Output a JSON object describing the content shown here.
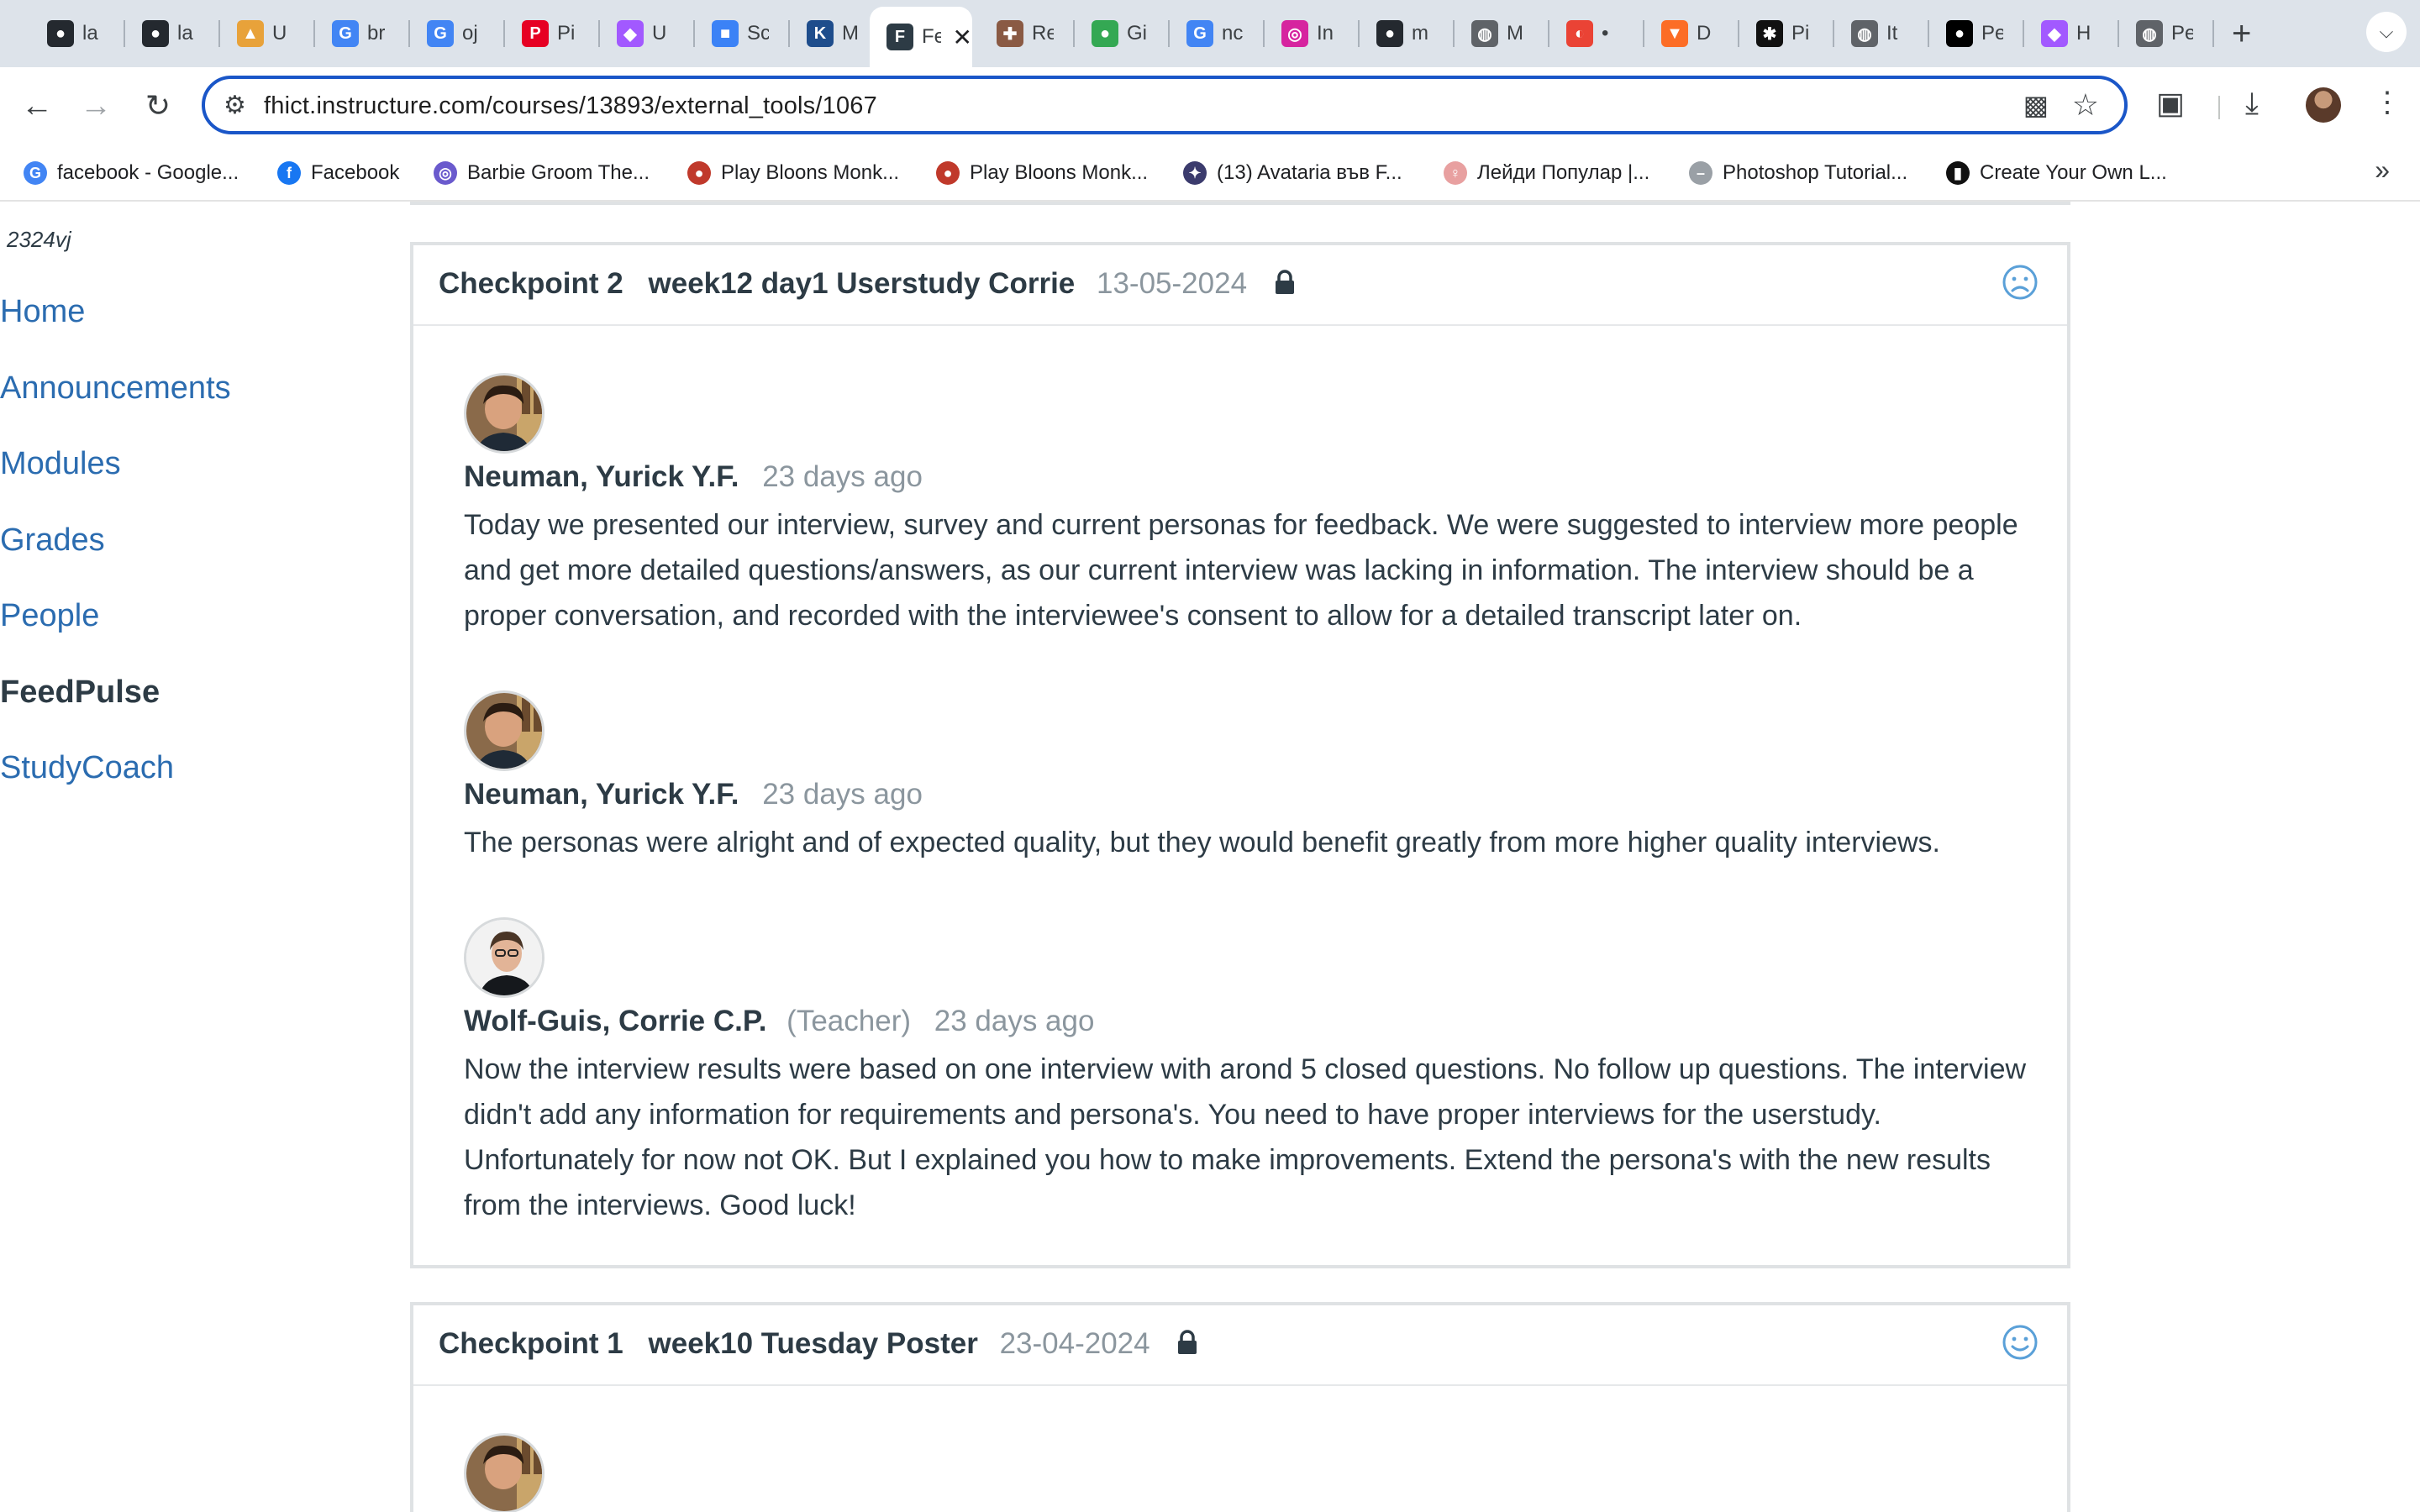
{
  "browser": {
    "tabs": [
      {
        "title": "la",
        "icon": "github-icon",
        "color": "#24292f"
      },
      {
        "title": "la",
        "icon": "github-icon",
        "color": "#24292f"
      },
      {
        "title": "U",
        "icon": "graduation-cap-icon",
        "color": "#e8a23a"
      },
      {
        "title": "br",
        "icon": "google-icon",
        "color": "#4285f4"
      },
      {
        "title": "oj",
        "icon": "google-icon",
        "color": "#4285f4"
      },
      {
        "title": "Pi",
        "icon": "pinterest-icon",
        "color": "#e60023"
      },
      {
        "title": "U",
        "icon": "figma-icon",
        "color": "#a259ff"
      },
      {
        "title": "Sc",
        "icon": "sketch-blocks-icon",
        "color": "#3b82f6"
      },
      {
        "title": "M",
        "icon": "k-icon",
        "color": "#1e4d8c"
      },
      {
        "title": "Fe",
        "icon": "feedpulse-icon",
        "color": "#2d3b45",
        "active": true
      },
      {
        "title": "Re",
        "icon": "puzzle-piece-icon",
        "color": "#8a5a44"
      },
      {
        "title": "Gi",
        "icon": "maps-pin-icon",
        "color": "#34a853"
      },
      {
        "title": "nc",
        "icon": "google-icon",
        "color": "#4285f4"
      },
      {
        "title": "In",
        "icon": "instagram-icon",
        "color": "#d6249f"
      },
      {
        "title": "m",
        "icon": "github-icon",
        "color": "#24292f"
      },
      {
        "title": "M",
        "icon": "globe-icon",
        "color": "#5f6368"
      },
      {
        "title": "•",
        "icon": "google-lens-icon",
        "color": "#ea4335"
      },
      {
        "title": "D",
        "icon": "gitlab-icon",
        "color": "#fc6d26"
      },
      {
        "title": "Pi",
        "icon": "black-logo-icon",
        "color": "#111111"
      },
      {
        "title": "It",
        "icon": "globe-icon",
        "color": "#5f6368"
      },
      {
        "title": "Pe",
        "icon": "medium-icon",
        "color": "#000000"
      },
      {
        "title": "H",
        "icon": "figma-icon",
        "color": "#a259ff"
      },
      {
        "title": "Pe",
        "icon": "globe-icon",
        "color": "#5f6368"
      }
    ],
    "url": "fhict.instructure.com/courses/13893/external_tools/1067",
    "bookmarks": [
      {
        "label": "facebook - Google...",
        "icon": "google-icon",
        "color": "#4285f4"
      },
      {
        "label": "Facebook",
        "icon": "facebook-icon",
        "color": "#1877f2"
      },
      {
        "label": "Barbie Groom The...",
        "icon": "barbie-icon",
        "color": "#6a5acd"
      },
      {
        "label": "Play Bloons Monk...",
        "icon": "bloons-icon",
        "color": "#c0392b"
      },
      {
        "label": "Play Bloons Monk...",
        "icon": "bloons-icon",
        "color": "#c0392b"
      },
      {
        "label": "(13) Avataria във F...",
        "icon": "avataria-icon",
        "color": "#3b3b6d"
      },
      {
        "label": "Лейди Популар |...",
        "icon": "lady-popular-icon",
        "color": "#e8a0a0"
      },
      {
        "label": "Photoshop Tutorial...",
        "icon": "dash-icon",
        "color": "#9aa0a6"
      },
      {
        "label": "Create Your Own L...",
        "icon": "black-square-icon",
        "color": "#111111"
      }
    ]
  },
  "sidebar": {
    "course_code": "2324vj",
    "items": [
      {
        "label": "Home",
        "active": false
      },
      {
        "label": "Announcements",
        "active": false
      },
      {
        "label": "Modules",
        "active": false
      },
      {
        "label": "Grades",
        "active": false
      },
      {
        "label": "People",
        "active": false
      },
      {
        "label": "FeedPulse",
        "active": true
      },
      {
        "label": "StudyCoach",
        "active": false
      }
    ]
  },
  "checkpoints": [
    {
      "name": "Checkpoint 2",
      "subtitle": "week12 day1 Userstudy Corrie",
      "date": "13-05-2024",
      "mood": "sad-face-icon",
      "comments": [
        {
          "author": "Neuman, Yurick Y.F.",
          "role": "",
          "ago": "23 days ago",
          "text": "Today we presented our interview, survey and current personas for feedback. We were suggested to interview more people and get more detailed questions/answers, as our current interview was lacking in information. The interview should be a proper conversation, and recorded with the interviewee's consent to allow for a detailed transcript later on."
        },
        {
          "author": "Neuman, Yurick Y.F.",
          "role": "",
          "ago": "23 days ago",
          "text": "The personas were alright and of expected quality, but they would benefit greatly from more higher quality interviews."
        },
        {
          "author": "Wolf-Guis, Corrie C.P.",
          "role": "(Teacher)",
          "ago": "23 days ago",
          "text": "Now the interview results were based on one interview with arond 5 closed questions. No follow up questions. The interview didn't add any information for requirements and persona's. You need to have proper interviews for the userstudy. Unfortunately for now not OK. But I explained you how to make improvements. Extend the persona's with the new results from the interviews. Good luck!"
        }
      ]
    },
    {
      "name": "Checkpoint 1",
      "subtitle": "week10 Tuesday Poster",
      "date": "23-04-2024",
      "mood": "happy-face-icon"
    }
  ],
  "colors": {
    "link": "#2b6cb0",
    "accent": "#1a56c8",
    "mood": "#5aa0d8"
  }
}
